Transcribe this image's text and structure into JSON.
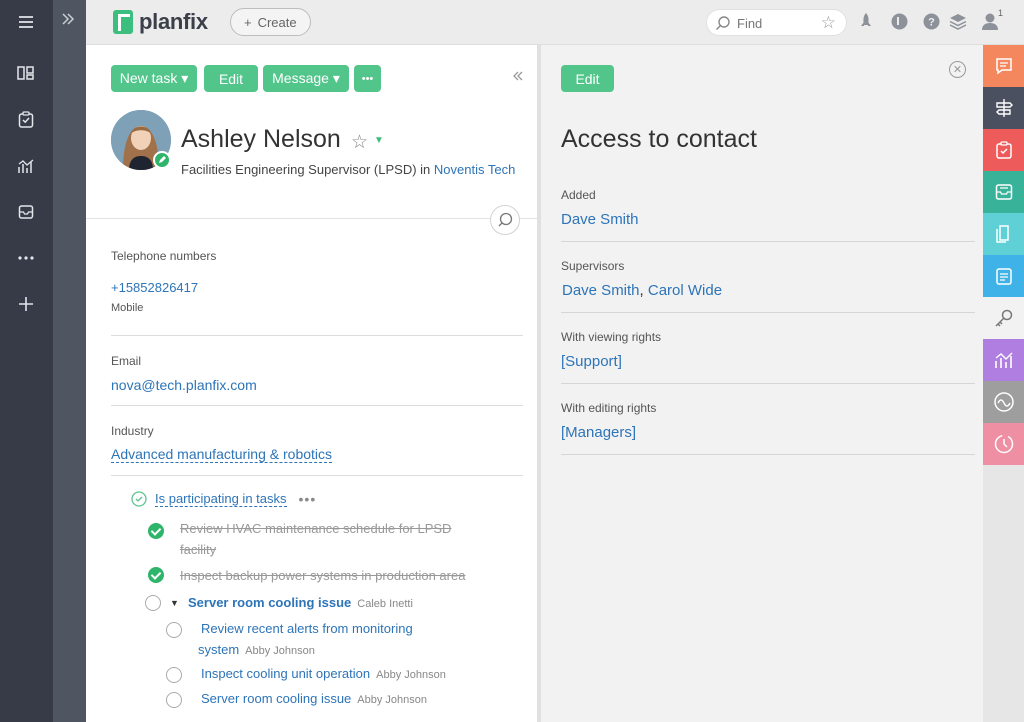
{
  "topbar": {
    "logo_text": "planfix",
    "create_label": "Create",
    "search_placeholder": "Find",
    "notification_count": "1"
  },
  "sidebar": {
    "items": [
      "menu-icon",
      "projects-icon",
      "tasks-icon",
      "analytics-icon",
      "inbox-icon",
      "more-icon",
      "add-icon"
    ]
  },
  "contact": {
    "buttons": {
      "new_task": "New task ▾",
      "edit": "Edit",
      "message": "Message ▾",
      "more": "•••"
    },
    "name": "Ashley Nelson",
    "position": "Facilities Engineering Supervisor (LPSD)",
    "position_in": "in",
    "company": "Noventis Tech",
    "fields": {
      "phone_label": "Telephone numbers",
      "phone_value": "+15852826417",
      "phone_type": "Mobile",
      "email_label": "Email",
      "email_value": "nova@tech.planfix.com",
      "industry_label": "Industry",
      "industry_value": "Advanced manufacturing & robotics"
    },
    "tasks": {
      "header": "Is participating in tasks",
      "items": [
        {
          "title_line1": "Review HVAC maintenance schedule for LPSD",
          "title_line2": "facility",
          "assignee": "",
          "status": "done"
        },
        {
          "title_line1": "Inspect backup power systems in production area",
          "title_line2": "",
          "assignee": "",
          "status": "done"
        },
        {
          "title_line1": "Server room cooling issue",
          "title_line2": "",
          "assignee": "Caleb Inetti",
          "status": "open"
        },
        {
          "title_line1": "Review recent alerts from monitoring",
          "title_line2": "system",
          "assignee": "Abby Johnson",
          "status": "open"
        },
        {
          "title_line1": "Inspect cooling unit operation",
          "title_line2": "",
          "assignee": "Abby Johnson",
          "status": "open"
        },
        {
          "title_line1": "Server room cooling issue",
          "title_line2": "",
          "assignee": "Abby Johnson",
          "status": "open"
        }
      ]
    }
  },
  "access": {
    "edit_label": "Edit",
    "title": "Access to contact",
    "added_label": "Added",
    "added_value": "Dave Smith",
    "supervisors_label": "Supervisors",
    "supervisor_1": "Dave Smith",
    "supervisor_sep": ",",
    "supervisor_2": "Carol Wide",
    "viewing_label": "With viewing rights",
    "viewing_value": "[Support]",
    "editing_label": "With editing rights",
    "editing_value": "[Managers]"
  },
  "right_strip": {
    "tiles": [
      {
        "icon": "chat-icon",
        "color": "#f4875e"
      },
      {
        "icon": "signpost-icon",
        "color": "#4a5060"
      },
      {
        "icon": "task-icon",
        "color": "#ee5b5b"
      },
      {
        "icon": "inbox-icon",
        "color": "#38b39a"
      },
      {
        "icon": "documents-icon",
        "color": "#5fd0d6"
      },
      {
        "icon": "checklist-icon",
        "color": "#3fb3e8"
      },
      {
        "icon": "key-icon",
        "color": "#f2f2f2"
      },
      {
        "icon": "analytics-icon",
        "color": "#b07ee0"
      },
      {
        "icon": "wave-icon",
        "color": "#9e9e9e"
      },
      {
        "icon": "history-icon",
        "color": "#ef8fa3"
      }
    ]
  }
}
